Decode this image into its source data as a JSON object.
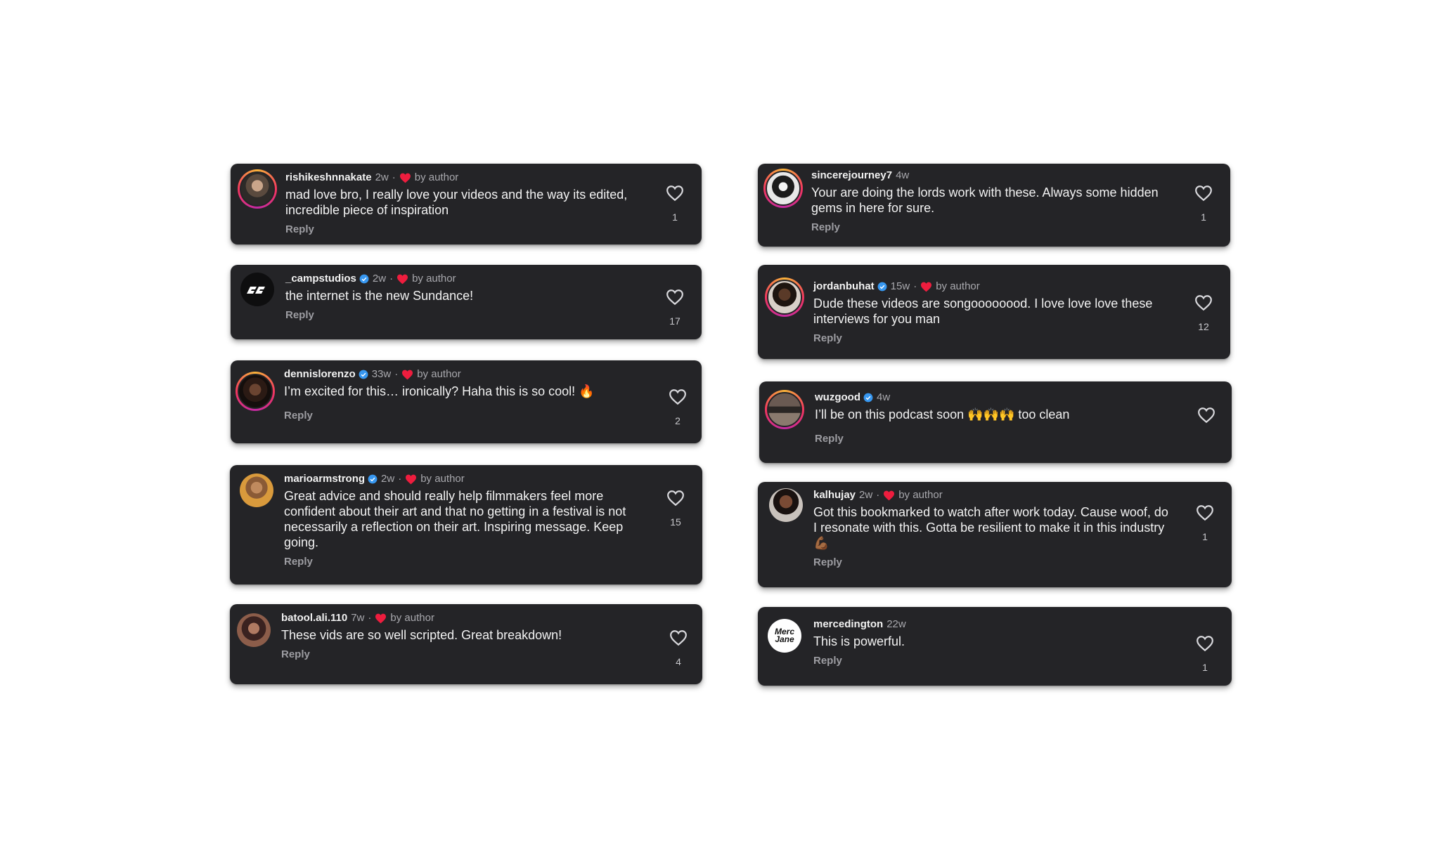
{
  "byAuthor": "by author",
  "replyLabel": "Reply",
  "colors": {
    "card": "#242427",
    "heart": "#ee1d3e",
    "verified": "#3797f0",
    "text": "#f2f2f2",
    "muted": "#a8a8ad"
  },
  "comments": [
    {
      "username": "rishikeshnnakate",
      "verified": false,
      "time": "2w",
      "liked_by_author": true,
      "text": "mad love bro, I really love your videos and the way its edited, incredible piece of inspiration",
      "likes": "1",
      "avatar_icon": "user-photo-avatar"
    },
    {
      "username": "_campstudios",
      "verified": true,
      "time": "2w",
      "liked_by_author": true,
      "text": "the internet is the new Sundance!",
      "likes": "17",
      "avatar_icon": "camp-studios-logo"
    },
    {
      "username": "dennislorenzo",
      "verified": true,
      "time": "33w",
      "liked_by_author": true,
      "text": "I’m excited for this… ironically? Haha this is so cool! 🔥",
      "likes": "2",
      "avatar_icon": "user-photo-avatar"
    },
    {
      "username": "marioarmstrong",
      "verified": true,
      "time": "2w",
      "liked_by_author": true,
      "text": "Great advice and should really help filmmakers feel more confident about their art and that no getting in a festival is not necessarily a reflection on their art. Inspiring message. Keep going.",
      "likes": "15",
      "avatar_icon": "user-photo-avatar"
    },
    {
      "username": "batool.ali.110",
      "verified": false,
      "time": "7w",
      "liked_by_author": true,
      "text": "These vids are so well scripted. Great breakdown!",
      "likes": "4",
      "avatar_icon": "user-photo-avatar"
    },
    {
      "username": "sincerejourney7",
      "verified": false,
      "time": "4w",
      "liked_by_author": false,
      "text": "Your are doing the lords work with these. Always some hidden gems in here for sure.",
      "likes": "1",
      "avatar_icon": "user-photo-avatar"
    },
    {
      "username": "jordanbuhat",
      "verified": true,
      "time": "15w",
      "liked_by_author": true,
      "text": "Dude these videos are songoooooood. I love love love these interviews for you man",
      "likes": "12",
      "avatar_icon": "user-photo-avatar"
    },
    {
      "username": "wuzgood",
      "verified": true,
      "time": "4w",
      "liked_by_author": false,
      "text": "I’ll be on this podcast soon 🙌🙌🙌 too clean",
      "likes": "",
      "avatar_icon": "user-photo-avatar"
    },
    {
      "username": "kalhujay",
      "verified": false,
      "time": "2w",
      "liked_by_author": true,
      "text": "Got this bookmarked to watch after work today. Cause woof, do I resonate with this. Gotta be resilient to make it in this industry 💪🏾",
      "likes": "1",
      "avatar_icon": "user-photo-avatar"
    },
    {
      "username": "mercedington",
      "verified": false,
      "time": "22w",
      "liked_by_author": false,
      "text": "This is powerful.",
      "likes": "1",
      "avatar_icon": "merc-jane-logo",
      "avatar_label": "Merc Jane"
    }
  ]
}
